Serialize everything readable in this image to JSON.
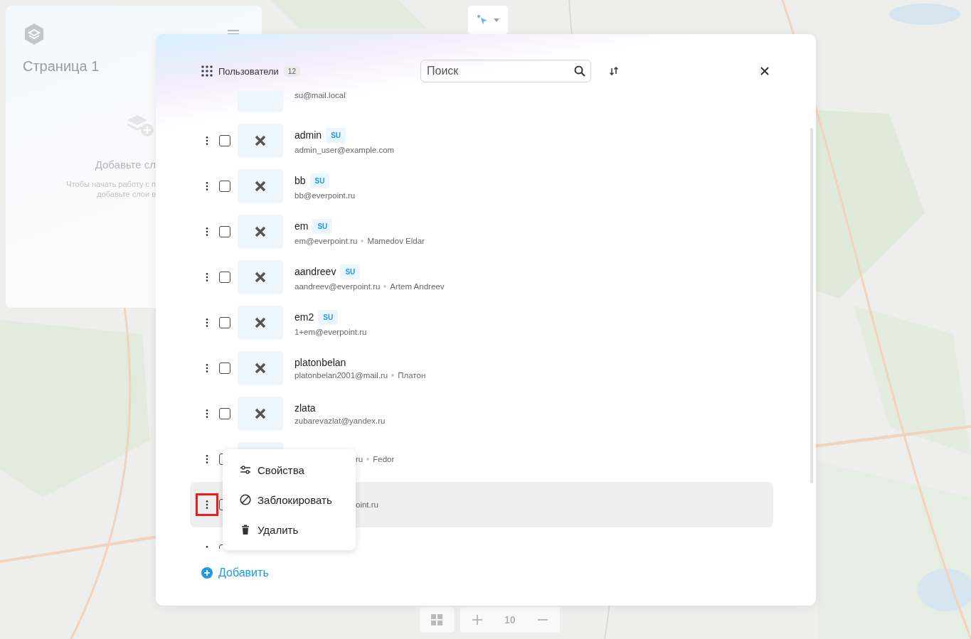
{
  "page_panel": {
    "title": "Страница 1",
    "empty_title": "Добавьте сл",
    "empty_text": [
      "Чтобы начать работу с п",
      "добавьте слои в"
    ]
  },
  "zoom_controls": {
    "zoom": "10"
  },
  "users_dialog": {
    "title": "Пользователи",
    "count": "12",
    "search": {
      "placeholder": "Поиск"
    },
    "rows": [
      {
        "email": "su@mail.local",
        "selected": false
      },
      {
        "name": "admin",
        "badge": "SU",
        "email": "admin_user@example.com",
        "no_avatar": true,
        "checked": false,
        "selected": false
      },
      {
        "name": "bb",
        "badge": "SU",
        "email": "bb@everpoint.ru",
        "no_avatar": true,
        "checked": false,
        "selected": false
      },
      {
        "name": "em",
        "badge": "SU",
        "email": "em@everpoint.ru",
        "full_name": "Mamedov Eldar",
        "no_avatar": true,
        "checked": false,
        "selected": false
      },
      {
        "name": "aandreev",
        "badge": "SU",
        "email": "aandreev@everpoint.ru",
        "full_name": "Artem Andreev",
        "no_avatar": true,
        "checked": false,
        "selected": false
      },
      {
        "name": "em2",
        "badge": "SU",
        "email": "1+em@everpoint.ru",
        "no_avatar": true,
        "checked": false,
        "selected": false
      },
      {
        "name": "platonbelan",
        "email": "platonbelan2001@mail.ru",
        "full_name": "Платон",
        "no_avatar": true,
        "checked": false,
        "selected": false
      },
      {
        "name": "zlata",
        "email": "zubarevazlat@yandex.ru",
        "no_avatar": true,
        "checked": false,
        "selected": false
      },
      {
        "email": "ru",
        "full_name": "Fedor",
        "covered": true,
        "checked": false,
        "selected": false
      },
      {
        "email": "oint.ru",
        "covered": true,
        "highlighted": true,
        "checked": false,
        "selected": true
      },
      {
        "checked": false,
        "selected": false
      }
    ],
    "context_menu": [
      {
        "kind": "properties",
        "label": "Свойства"
      },
      {
        "kind": "block",
        "label": "Заблокировать"
      },
      {
        "kind": "delete",
        "label": "Удалить"
      }
    ],
    "add_button": "Добавить"
  }
}
